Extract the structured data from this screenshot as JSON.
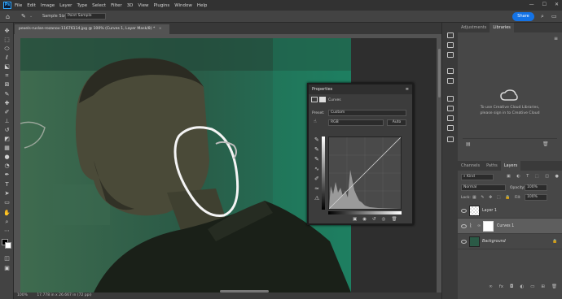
{
  "app": {
    "logo": "Ps",
    "menu": [
      "File",
      "Edit",
      "Image",
      "Layer",
      "Type",
      "Select",
      "Filter",
      "3D",
      "View",
      "Plugins",
      "Window",
      "Help"
    ],
    "window_controls": [
      "—",
      "☐",
      "✕"
    ]
  },
  "options_bar": {
    "sample_size_label": "Sample Size:",
    "sample_size_value": "Point Sample",
    "share_label": "Share"
  },
  "document": {
    "tab_title": "pexels-ruslan-rozanov-11676114.jpg @ 100% (Curves 1, Layer Mask/8) *",
    "tab_close": "×",
    "status_zoom": "100%",
    "status_info": "17.778 in x 26.667 in (72 ppi)"
  },
  "properties": {
    "title": "Properties",
    "adjustment_name": "Curves",
    "preset_label": "Preset:",
    "preset_value": "Custom",
    "channel_value": "RGB",
    "auto_label": "Auto"
  },
  "libraries": {
    "tabs": [
      "Adjustments",
      "Libraries"
    ],
    "active_tab": "Libraries",
    "message_line1": "To use Creative Cloud Libraries,",
    "message_line2": "please sign in to Creative Cloud"
  },
  "layers_panel": {
    "tabs": [
      "Channels",
      "Paths",
      "Layers"
    ],
    "active_tab": "Layers",
    "kind_label": "Kind",
    "blend_mode": "Normal",
    "opacity_label": "Opacity:",
    "opacity_value": "100%",
    "lock_label": "Lock:",
    "fill_label": "Fill:",
    "fill_value": "100%",
    "layers": [
      {
        "name": "Layer 1",
        "visible": true
      },
      {
        "name": "Curves 1",
        "visible": true,
        "selected": true
      },
      {
        "name": "Background",
        "visible": true,
        "locked": true
      }
    ]
  },
  "colors": {
    "accent": "#1473e6",
    "canvas_tint": "#28503e",
    "panel_bg": "#474747"
  }
}
